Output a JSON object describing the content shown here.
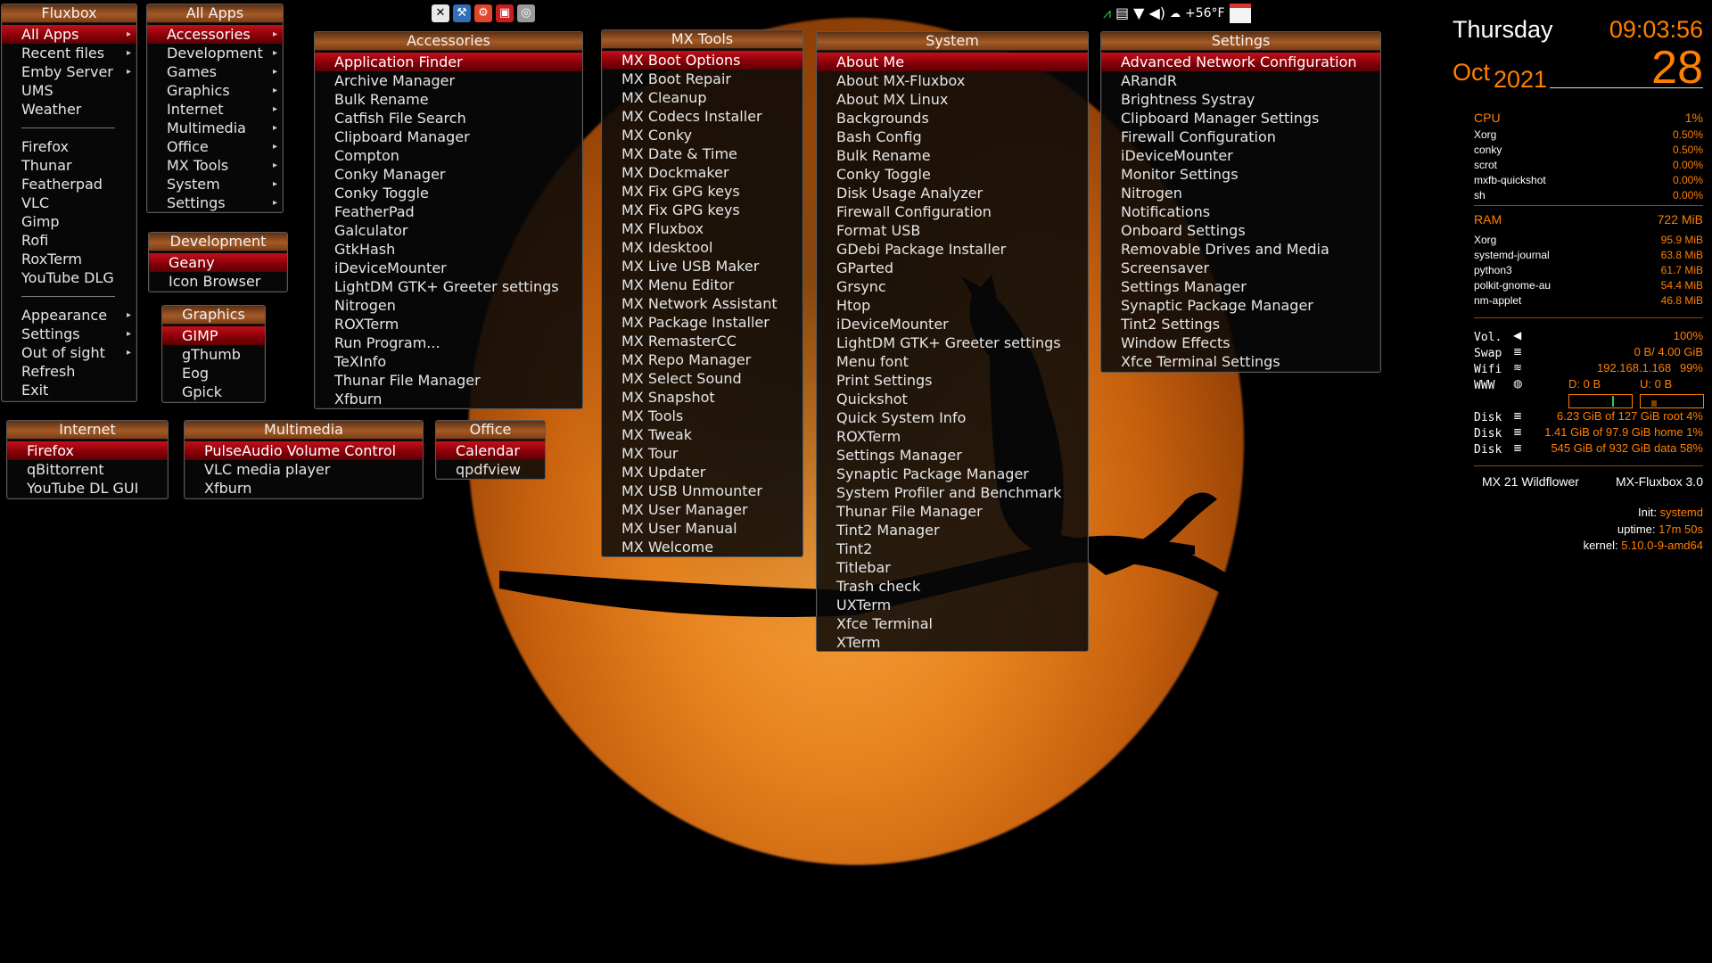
{
  "menus": {
    "fluxbox": {
      "title": "Fluxbox",
      "items": [
        {
          "label": "All Apps",
          "active": true,
          "submenu": true
        },
        {
          "label": "Recent files",
          "submenu": true
        },
        {
          "label": "Emby Server",
          "submenu": true
        },
        {
          "label": "UMS"
        },
        {
          "label": "Weather"
        },
        {
          "separator": true
        },
        {
          "label": "Firefox"
        },
        {
          "label": "Thunar"
        },
        {
          "label": "Featherpad"
        },
        {
          "label": "VLC"
        },
        {
          "label": "Gimp"
        },
        {
          "label": "Rofi"
        },
        {
          "label": "RoxTerm"
        },
        {
          "label": "YouTube DLG"
        },
        {
          "separator": true
        },
        {
          "label": "Appearance",
          "submenu": true
        },
        {
          "label": "Settings",
          "submenu": true
        },
        {
          "label": "Out of sight",
          "submenu": true
        },
        {
          "label": "Refresh"
        },
        {
          "label": "Exit"
        }
      ]
    },
    "all_apps": {
      "title": "All Apps",
      "items": [
        {
          "label": "Accessories",
          "active": true,
          "submenu": true
        },
        {
          "label": "Development",
          "submenu": true
        },
        {
          "label": "Games",
          "submenu": true
        },
        {
          "label": "Graphics",
          "submenu": true
        },
        {
          "label": "Internet",
          "submenu": true
        },
        {
          "label": "Multimedia",
          "submenu": true
        },
        {
          "label": "Office",
          "submenu": true
        },
        {
          "label": "MX Tools",
          "submenu": true
        },
        {
          "label": "System",
          "submenu": true
        },
        {
          "label": "Settings",
          "submenu": true
        }
      ]
    },
    "development": {
      "title": "Development",
      "items": [
        {
          "label": "Geany",
          "active": true
        },
        {
          "label": "Icon Browser"
        }
      ]
    },
    "graphics": {
      "title": "Graphics",
      "items": [
        {
          "label": "GIMP",
          "active": true
        },
        {
          "label": "gThumb"
        },
        {
          "label": "Eog"
        },
        {
          "label": "Gpick"
        }
      ]
    },
    "internet": {
      "title": "Internet",
      "items": [
        {
          "label": "Firefox",
          "active": true
        },
        {
          "label": "qBittorrent"
        },
        {
          "label": "YouTube DL GUI"
        }
      ]
    },
    "multimedia": {
      "title": "Multimedia",
      "items": [
        {
          "label": "PulseAudio Volume Control",
          "active": true
        },
        {
          "label": "VLC media player"
        },
        {
          "label": "Xfburn"
        }
      ]
    },
    "office": {
      "title": "Office",
      "items": [
        {
          "label": "Calendar",
          "active": true
        },
        {
          "label": "qpdfview"
        }
      ]
    },
    "accessories": {
      "title": "Accessories",
      "items": [
        {
          "label": "Application Finder",
          "active": true
        },
        {
          "label": "Archive Manager"
        },
        {
          "label": "Bulk Rename"
        },
        {
          "label": "Catfish File Search"
        },
        {
          "label": "Clipboard Manager"
        },
        {
          "label": "Compton"
        },
        {
          "label": "Conky Manager"
        },
        {
          "label": "Conky Toggle"
        },
        {
          "label": "FeatherPad"
        },
        {
          "label": "Galculator"
        },
        {
          "label": "GtkHash"
        },
        {
          "label": "iDeviceMounter"
        },
        {
          "label": "LightDM GTK+ Greeter settings"
        },
        {
          "label": "Nitrogen"
        },
        {
          "label": "ROXTerm"
        },
        {
          "label": "Run Program..."
        },
        {
          "label": "TeXInfo"
        },
        {
          "label": "Thunar File Manager"
        },
        {
          "label": "Xfburn"
        }
      ]
    },
    "mx_tools": {
      "title": "MX Tools",
      "items": [
        {
          "label": "MX Boot Options",
          "active": true
        },
        {
          "label": "MX Boot Repair"
        },
        {
          "label": "MX Cleanup"
        },
        {
          "label": "MX Codecs Installer"
        },
        {
          "label": "MX Conky"
        },
        {
          "label": "MX Date & Time"
        },
        {
          "label": "MX Dockmaker"
        },
        {
          "label": "MX Fix GPG keys"
        },
        {
          "label": "MX Fix GPG keys"
        },
        {
          "label": "MX Fluxbox"
        },
        {
          "label": "MX Idesktool"
        },
        {
          "label": "MX Live USB Maker"
        },
        {
          "label": "MX Menu Editor"
        },
        {
          "label": "MX Network Assistant"
        },
        {
          "label": "MX Package Installer"
        },
        {
          "label": "MX RemasterCC"
        },
        {
          "label": "MX Repo Manager"
        },
        {
          "label": "MX Select Sound"
        },
        {
          "label": "MX Snapshot"
        },
        {
          "label": "MX Tools"
        },
        {
          "label": "MX Tweak"
        },
        {
          "label": "MX Tour"
        },
        {
          "label": "MX Updater"
        },
        {
          "label": "MX USB Unmounter"
        },
        {
          "label": "MX User Manager"
        },
        {
          "label": "MX User Manual"
        },
        {
          "label": "MX Welcome"
        }
      ]
    },
    "system": {
      "title": "System",
      "items": [
        {
          "label": "About Me",
          "active": true
        },
        {
          "label": "About MX-Fluxbox"
        },
        {
          "label": "About MX Linux"
        },
        {
          "label": "Backgrounds"
        },
        {
          "label": "Bash Config"
        },
        {
          "label": "Bulk Rename"
        },
        {
          "label": "Conky Toggle"
        },
        {
          "label": "Disk Usage Analyzer"
        },
        {
          "label": "Firewall Configuration"
        },
        {
          "label": "Format USB"
        },
        {
          "label": "GDebi Package Installer"
        },
        {
          "label": "GParted"
        },
        {
          "label": "Grsync"
        },
        {
          "label": "Htop"
        },
        {
          "label": "iDeviceMounter"
        },
        {
          "label": "LightDM GTK+ Greeter settings"
        },
        {
          "label": "Menu font"
        },
        {
          "label": "Print Settings"
        },
        {
          "label": "Quickshot"
        },
        {
          "label": "Quick System Info"
        },
        {
          "label": "ROXTerm"
        },
        {
          "label": "Settings Manager"
        },
        {
          "label": "Synaptic Package Manager"
        },
        {
          "label": "System Profiler and Benchmark"
        },
        {
          "label": "Thunar File Manager"
        },
        {
          "label": "Tint2 Manager"
        },
        {
          "label": "Tint2"
        },
        {
          "label": "Titlebar"
        },
        {
          "label": "Trash check"
        },
        {
          "label": "UXTerm"
        },
        {
          "label": "Xfce Terminal"
        },
        {
          "label": "XTerm"
        }
      ]
    },
    "settings": {
      "title": "Settings",
      "items": [
        {
          "label": "Advanced Network Configuration",
          "active": true
        },
        {
          "label": "ARandR"
        },
        {
          "label": "Brightness Systray"
        },
        {
          "label": "Clipboard Manager Settings"
        },
        {
          "label": "Firewall Configuration"
        },
        {
          "label": "iDeviceMounter"
        },
        {
          "label": "Monitor Settings"
        },
        {
          "label": "Nitrogen"
        },
        {
          "label": "Notifications"
        },
        {
          "label": "Onboard Settings"
        },
        {
          "label": "Removable Drives and Media"
        },
        {
          "label": "Screensaver"
        },
        {
          "label": "Settings Manager"
        },
        {
          "label": "Synaptic Package Manager"
        },
        {
          "label": "Tint2 Settings"
        },
        {
          "label": "Window Effects"
        },
        {
          "label": "Xfce Terminal Settings"
        }
      ]
    }
  },
  "toolbar": {
    "launchers": [
      {
        "icon": "terminal-icon",
        "glyph": "✕",
        "bg": "#e8e8e8",
        "fg": "#000000"
      },
      {
        "icon": "tools-icon",
        "glyph": "⚒",
        "bg": "#2f6fb8",
        "fg": "#ffffff"
      },
      {
        "icon": "settings-icon",
        "glyph": "⚙",
        "bg": "#e0462c",
        "fg": "#ffffff"
      },
      {
        "icon": "screenshot-icon",
        "glyph": "▣",
        "bg": "#c81e1e",
        "fg": "#ffffff"
      },
      {
        "icon": "camera-icon",
        "glyph": "◎",
        "bg": "#9a9a9a",
        "fg": "#ffffff"
      }
    ],
    "tray": {
      "temperature": "+56°F"
    }
  },
  "conky": {
    "day": "Thursday",
    "time": "09:03:56",
    "month": "Oct",
    "year": "2021",
    "date": "28",
    "cpu": {
      "label": "CPU",
      "value": "1%",
      "processes": [
        {
          "name": "Xorg",
          "value": "0.50%"
        },
        {
          "name": "conky",
          "value": "0.50%"
        },
        {
          "name": "scrot",
          "value": "0.00%"
        },
        {
          "name": "mxfb-quickshot",
          "value": "0.00%"
        },
        {
          "name": "sh",
          "value": "0.00%"
        }
      ]
    },
    "ram": {
      "label": "RAM",
      "value": "722 MiB",
      "processes": [
        {
          "name": "Xorg",
          "value": "95.9 MiB"
        },
        {
          "name": "systemd-journal",
          "value": "63.8 MiB"
        },
        {
          "name": "python3",
          "value": "61.7 MiB"
        },
        {
          "name": "polkit-gnome-au",
          "value": "54.4 MiB"
        },
        {
          "name": "nm-applet",
          "value": "46.8 MiB"
        }
      ]
    },
    "vol": {
      "label": "Vol.",
      "value": "100%"
    },
    "swap": {
      "label": "Swap",
      "value": "0 B/ 4.00 GiB"
    },
    "wifi": {
      "label": "Wifi",
      "ip": "192.168.1.168",
      "value": "99%"
    },
    "www": {
      "label": "WWW",
      "down": "D: 0 B",
      "up": "U: 0 B"
    },
    "disks": [
      {
        "label": "Disk",
        "value": "6.23 GiB of 127 GiB root 4%"
      },
      {
        "label": "Disk",
        "value": "1.41 GiB of 97.9 GiB home 1%"
      },
      {
        "label": "Disk",
        "value": "545 GiB of 932 GiB data 58%"
      }
    ],
    "os": "MX 21 Wildflower",
    "wm": "MX-Fluxbox 3.0",
    "init": {
      "label": "Init:",
      "value": "systemd"
    },
    "uptime": {
      "label": "uptime:",
      "value": "17m 50s"
    },
    "kernel": {
      "label": "kernel:",
      "value": "5.10.0-9-amd64"
    },
    "colors": {
      "accent": "#ff7f00",
      "text": "#ffffff",
      "menu_active": "#b00010"
    }
  }
}
